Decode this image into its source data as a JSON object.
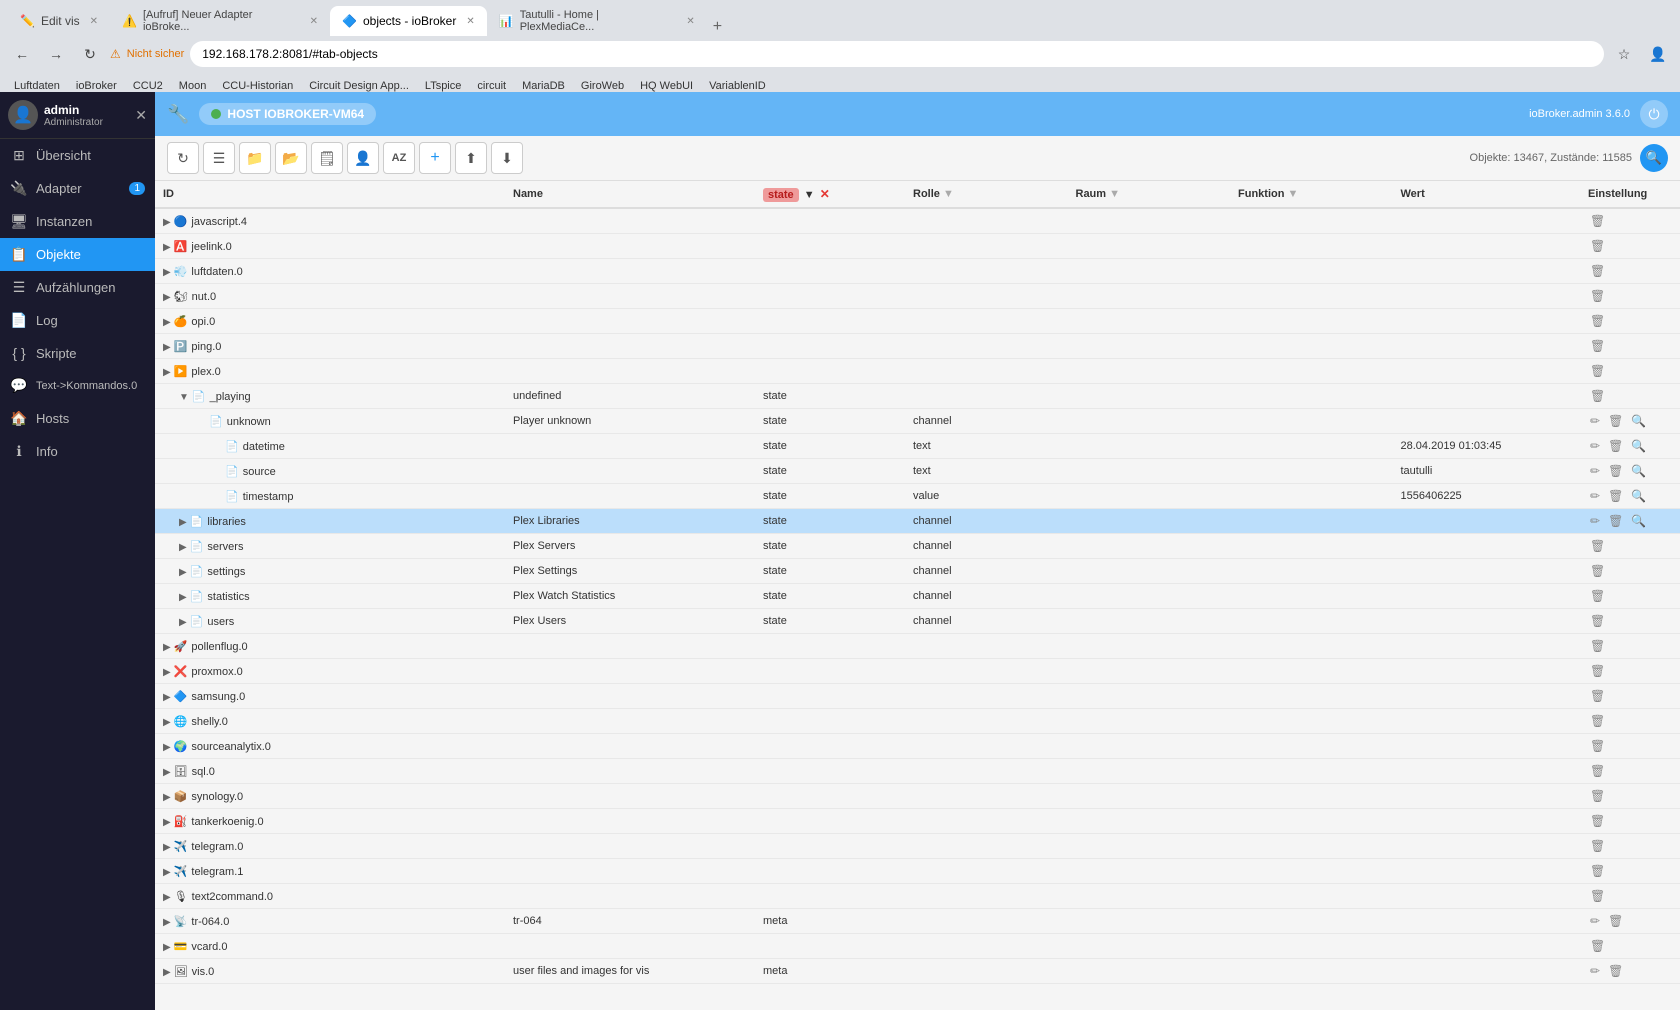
{
  "browser": {
    "tabs": [
      {
        "id": "tab-edit-vis",
        "label": "Edit vis",
        "active": false,
        "favicon": "✏️"
      },
      {
        "id": "tab-adapter",
        "label": "[Aufruf] Neuer Adapter ioBroke...",
        "active": false,
        "favicon": "⚠️"
      },
      {
        "id": "tab-objects",
        "label": "objects - ioBroker",
        "active": true,
        "favicon": "🔷"
      },
      {
        "id": "tab-tautulli",
        "label": "Tautulli - Home | PlexMediaCe...",
        "active": false,
        "favicon": "📊"
      }
    ],
    "address": "192.168.178.2:8081/#tab-objects",
    "security_warning": "Nicht sicher",
    "bookmarks": [
      "Luftdaten",
      "ioBroker",
      "CCU2",
      "Moon",
      "CCU-Historian",
      "Circuit Design App...",
      "LTspice",
      "circuit",
      "MariaDB",
      "GiroWeb",
      "HQ WebUI",
      "VariablenID"
    ]
  },
  "topbar": {
    "host_name": "HOST IOBROKER-VM64",
    "version_info": "ioBroker.admin 3.6.0",
    "wrench_icon": "🔧",
    "power_icon": "⏻"
  },
  "toolbar": {
    "objects_count": "Objekte: 13467, Zustände: 11585",
    "buttons": [
      "↻",
      "☰",
      "📁",
      "📂",
      "🗒",
      "👤",
      "AZ",
      "+",
      "⬆",
      "⬇"
    ]
  },
  "columns": {
    "id": "ID",
    "name": "Name",
    "state": "state",
    "rolle": "Rolle",
    "raum": "Raum",
    "funktion": "Funktion",
    "wert": "Wert",
    "einstellung": "Einstellung"
  },
  "sidebar": {
    "user_name": "admin",
    "user_role": "Administrator",
    "menu_items": [
      {
        "id": "ubersicht",
        "label": "Übersicht",
        "icon": "⊞",
        "active": false
      },
      {
        "id": "adapter",
        "label": "Adapter",
        "icon": "🔌",
        "badge": "1",
        "active": false
      },
      {
        "id": "instanzen",
        "label": "Instanzen",
        "icon": "🖥",
        "active": false
      },
      {
        "id": "objekte",
        "label": "Objekte",
        "icon": "📋",
        "active": true
      },
      {
        "id": "aufzahlungen",
        "label": "Aufzählungen",
        "icon": "☰",
        "active": false
      },
      {
        "id": "log",
        "label": "Log",
        "icon": "📄",
        "active": false
      },
      {
        "id": "skripte",
        "label": "Skripte",
        "icon": "{ }",
        "active": false
      },
      {
        "id": "text-kommandos",
        "label": "Text->Kommandos.0",
        "icon": "💬",
        "active": false
      },
      {
        "id": "hosts",
        "label": "Hosts",
        "icon": "🏠",
        "active": false
      },
      {
        "id": "info",
        "label": "Info",
        "icon": "ℹ",
        "active": false
      }
    ]
  },
  "table_rows": [
    {
      "indent": 1,
      "id": "javascript.4",
      "name": "",
      "icon": "🔵",
      "state": "",
      "rolle": "",
      "raum": "",
      "funktion": "",
      "wert": "",
      "actions": [
        "delete"
      ]
    },
    {
      "indent": 1,
      "id": "jeelink.0",
      "name": "",
      "icon": "🅰️",
      "state": "",
      "rolle": "",
      "raum": "",
      "funktion": "",
      "wert": "",
      "actions": [
        "delete"
      ]
    },
    {
      "indent": 1,
      "id": "luftdaten.0",
      "name": "",
      "icon": "💨",
      "state": "",
      "rolle": "",
      "raum": "",
      "funktion": "",
      "wert": "",
      "actions": [
        "delete"
      ]
    },
    {
      "indent": 1,
      "id": "nut.0",
      "name": "",
      "icon": "🐿",
      "state": "",
      "rolle": "",
      "raum": "",
      "funktion": "",
      "wert": "",
      "actions": [
        "delete"
      ]
    },
    {
      "indent": 1,
      "id": "opi.0",
      "name": "",
      "icon": "🍊",
      "state": "",
      "rolle": "",
      "raum": "",
      "funktion": "",
      "wert": "",
      "actions": [
        "delete"
      ]
    },
    {
      "indent": 1,
      "id": "ping.0",
      "name": "",
      "icon": "🅿️",
      "state": "",
      "rolle": "",
      "raum": "",
      "funktion": "",
      "wert": "",
      "actions": [
        "delete"
      ]
    },
    {
      "indent": 1,
      "id": "plex.0",
      "name": "",
      "icon": "▶️",
      "state": "",
      "rolle": "",
      "raum": "",
      "funktion": "",
      "wert": "",
      "actions": [
        "delete"
      ]
    },
    {
      "indent": 2,
      "id": "_playing",
      "name": "undefined",
      "icon": "📄",
      "state": "state",
      "rolle": "",
      "raum": "",
      "funktion": "",
      "wert": "",
      "actions": [
        "delete"
      ]
    },
    {
      "indent": 3,
      "id": "unknown",
      "name": "Player unknown",
      "icon": "📄",
      "state": "state",
      "rolle": "channel",
      "raum": "",
      "funktion": "",
      "wert": "",
      "actions": [
        "edit",
        "delete",
        "search"
      ]
    },
    {
      "indent": 4,
      "id": "datetime",
      "name": "",
      "icon": "📄",
      "state": "state",
      "rolle": "text",
      "raum": "",
      "funktion": "",
      "wert": "28.04.2019 01:03:45",
      "actions": [
        "edit",
        "delete",
        "search"
      ]
    },
    {
      "indent": 4,
      "id": "source",
      "name": "",
      "icon": "📄",
      "state": "state",
      "rolle": "text",
      "raum": "",
      "funktion": "",
      "wert": "tautulli",
      "actions": [
        "edit",
        "delete",
        "search"
      ]
    },
    {
      "indent": 4,
      "id": "timestamp",
      "name": "",
      "icon": "📄",
      "state": "state",
      "rolle": "value",
      "raum": "",
      "funktion": "",
      "wert": "1556406225",
      "actions": [
        "edit",
        "delete",
        "search"
      ]
    },
    {
      "indent": 2,
      "id": "libraries",
      "name": "Plex Libraries",
      "icon": "📄",
      "state": "state",
      "rolle": "channel",
      "raum": "",
      "funktion": "",
      "wert": "",
      "actions": [
        "edit",
        "delete",
        "search"
      ],
      "selected": true
    },
    {
      "indent": 2,
      "id": "servers",
      "name": "Plex Servers",
      "icon": "📄",
      "state": "state",
      "rolle": "channel",
      "raum": "",
      "funktion": "",
      "wert": "",
      "actions": [
        "delete"
      ]
    },
    {
      "indent": 2,
      "id": "settings",
      "name": "Plex Settings",
      "icon": "📄",
      "state": "state",
      "rolle": "channel",
      "raum": "",
      "funktion": "",
      "wert": "",
      "actions": [
        "delete"
      ]
    },
    {
      "indent": 2,
      "id": "statistics",
      "name": "Plex Watch Statistics",
      "icon": "📄",
      "state": "state",
      "rolle": "channel",
      "raum": "",
      "funktion": "",
      "wert": "",
      "actions": [
        "delete"
      ]
    },
    {
      "indent": 2,
      "id": "users",
      "name": "Plex Users",
      "icon": "📄",
      "state": "state",
      "rolle": "channel",
      "raum": "",
      "funktion": "",
      "wert": "",
      "actions": [
        "delete"
      ]
    },
    {
      "indent": 1,
      "id": "pollenflug.0",
      "name": "",
      "icon": "🚀",
      "state": "",
      "rolle": "",
      "raum": "",
      "funktion": "",
      "wert": "",
      "actions": [
        "delete"
      ]
    },
    {
      "indent": 1,
      "id": "proxmox.0",
      "name": "",
      "icon": "❌",
      "state": "",
      "rolle": "",
      "raum": "",
      "funktion": "",
      "wert": "",
      "actions": [
        "delete"
      ]
    },
    {
      "indent": 1,
      "id": "samsung.0",
      "name": "",
      "icon": "🔷",
      "state": "",
      "rolle": "",
      "raum": "",
      "funktion": "",
      "wert": "",
      "actions": [
        "delete"
      ]
    },
    {
      "indent": 1,
      "id": "shelly.0",
      "name": "",
      "icon": "🌐",
      "state": "",
      "rolle": "",
      "raum": "",
      "funktion": "",
      "wert": "",
      "actions": [
        "delete"
      ]
    },
    {
      "indent": 1,
      "id": "sourceanalytix.0",
      "name": "",
      "icon": "🌍",
      "state": "",
      "rolle": "",
      "raum": "",
      "funktion": "",
      "wert": "",
      "actions": [
        "delete"
      ]
    },
    {
      "indent": 1,
      "id": "sql.0",
      "name": "",
      "icon": "🗄",
      "state": "",
      "rolle": "",
      "raum": "",
      "funktion": "",
      "wert": "",
      "actions": [
        "delete"
      ]
    },
    {
      "indent": 1,
      "id": "synology.0",
      "name": "",
      "icon": "📦",
      "state": "",
      "rolle": "",
      "raum": "",
      "funktion": "",
      "wert": "",
      "actions": [
        "delete"
      ]
    },
    {
      "indent": 1,
      "id": "tankerkoenig.0",
      "name": "",
      "icon": "⛽",
      "state": "",
      "rolle": "",
      "raum": "",
      "funktion": "",
      "wert": "",
      "actions": [
        "delete"
      ]
    },
    {
      "indent": 1,
      "id": "telegram.0",
      "name": "",
      "icon": "✈️",
      "state": "",
      "rolle": "",
      "raum": "",
      "funktion": "",
      "wert": "",
      "actions": [
        "delete"
      ]
    },
    {
      "indent": 1,
      "id": "telegram.1",
      "name": "",
      "icon": "✈️",
      "state": "",
      "rolle": "",
      "raum": "",
      "funktion": "",
      "wert": "",
      "actions": [
        "delete"
      ]
    },
    {
      "indent": 1,
      "id": "text2command.0",
      "name": "",
      "icon": "🎙",
      "state": "",
      "rolle": "",
      "raum": "",
      "funktion": "",
      "wert": "",
      "actions": [
        "delete"
      ]
    },
    {
      "indent": 1,
      "id": "tr-064.0",
      "name": "tr-064",
      "icon": "📡",
      "state": "meta",
      "rolle": "",
      "raum": "",
      "funktion": "",
      "wert": "",
      "actions": [
        "edit",
        "delete"
      ]
    },
    {
      "indent": 1,
      "id": "vcard.0",
      "name": "",
      "icon": "💳",
      "state": "",
      "rolle": "",
      "raum": "",
      "funktion": "",
      "wert": "",
      "actions": [
        "delete"
      ]
    },
    {
      "indent": 1,
      "id": "vis.0",
      "name": "user files and images for vis",
      "icon": "🖼",
      "state": "meta",
      "rolle": "",
      "raum": "",
      "funktion": "",
      "wert": "",
      "actions": [
        "edit",
        "delete"
      ]
    }
  ]
}
